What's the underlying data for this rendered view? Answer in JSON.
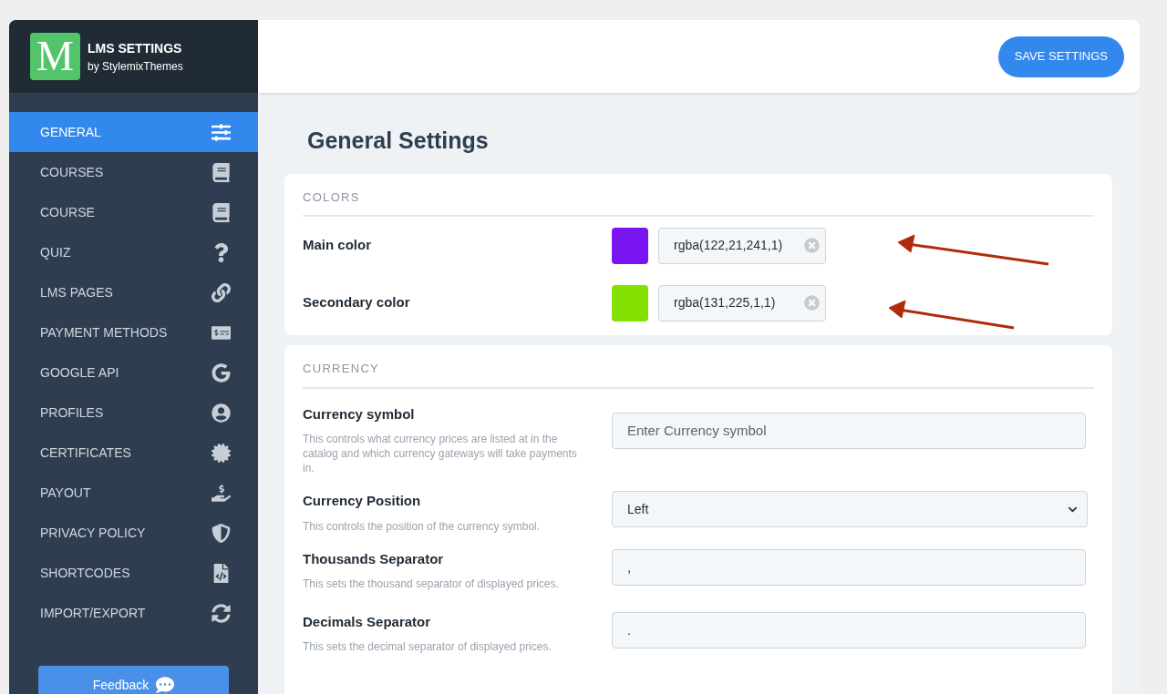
{
  "brand": {
    "logo_letter": "M",
    "title": "LMS SETTINGS",
    "subtitle": "by StylemixThemes"
  },
  "nav": [
    {
      "label": "GENERAL",
      "selected": true
    },
    {
      "label": "COURSES",
      "selected": false
    },
    {
      "label": "COURSE",
      "selected": false
    },
    {
      "label": "QUIZ",
      "selected": false
    },
    {
      "label": "LMS PAGES",
      "selected": false
    },
    {
      "label": "PAYMENT METHODS",
      "selected": false
    },
    {
      "label": "GOOGLE API",
      "selected": false
    },
    {
      "label": "PROFILES",
      "selected": false
    },
    {
      "label": "CERTIFICATES",
      "selected": false
    },
    {
      "label": "PAYOUT",
      "selected": false
    },
    {
      "label": "PRIVACY POLICY",
      "selected": false
    },
    {
      "label": "SHORTCODES",
      "selected": false
    },
    {
      "label": "IMPORT/EXPORT",
      "selected": false
    }
  ],
  "feedback_button": "Feedback",
  "save_button": "SAVE SETTINGS",
  "page_title": "General Settings",
  "colors_section": {
    "title": "COLORS",
    "rows": [
      {
        "label": "Main color",
        "value": "rgba(122,21,241,1)",
        "color": "#7a15f1"
      },
      {
        "label": "Secondary color",
        "value": "rgba(131,225,1,1)",
        "color": "#83e101"
      }
    ]
  },
  "currency_section": {
    "title": "CURRENCY",
    "rows": [
      {
        "label": "Currency symbol",
        "description": "This controls what currency prices are listed at in the catalog and which currency gateways will take payments in.",
        "kind": "text",
        "placeholder": "Enter Currency symbol"
      },
      {
        "label": "Currency Position",
        "description": "This controls the position of the currency symbol.",
        "kind": "select",
        "value": "Left"
      },
      {
        "label": "Thousands Separator",
        "description": "This sets the thousand separator of displayed prices.",
        "kind": "text",
        "value": ","
      },
      {
        "label": "Decimals Separator",
        "description": "This sets the decimal separator of displayed prices.",
        "kind": "text",
        "value": "."
      }
    ]
  }
}
